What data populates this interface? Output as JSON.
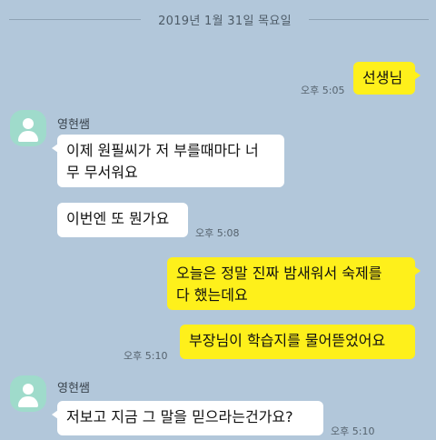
{
  "date_divider": "2019년 1월 31일 목요일",
  "messages": [
    {
      "sender": "me",
      "lines": [
        "선생님"
      ],
      "time": "오후 5:05"
    },
    {
      "sender": "영현쌤",
      "lines": [
        "이제 원필씨가 저 부를때마다 너",
        "무 무서워요"
      ],
      "time": ""
    },
    {
      "sender": "영현쌤",
      "lines": [
        "이번엔 또 뭔가요"
      ],
      "time": "오후 5:08"
    },
    {
      "sender": "me",
      "lines": [
        "오늘은 정말 진짜 밤새워서 숙제를",
        "다 했는데요"
      ],
      "time": ""
    },
    {
      "sender": "me",
      "lines": [
        "부장님이 학습지를 물어뜯었어요"
      ],
      "time": "오후 5:10"
    },
    {
      "sender": "영현쌤",
      "lines": [
        "저보고 지금 그 말을 믿으라는건가요?"
      ],
      "time": "오후 5:10"
    }
  ],
  "profile": {
    "name": "영현쌤",
    "avatar_icon": "default-profile-icon"
  },
  "colors": {
    "background": "#b2c7da",
    "my_bubble": "#fef01b",
    "other_bubble": "#ffffff",
    "avatar": "#9fdbcb"
  }
}
